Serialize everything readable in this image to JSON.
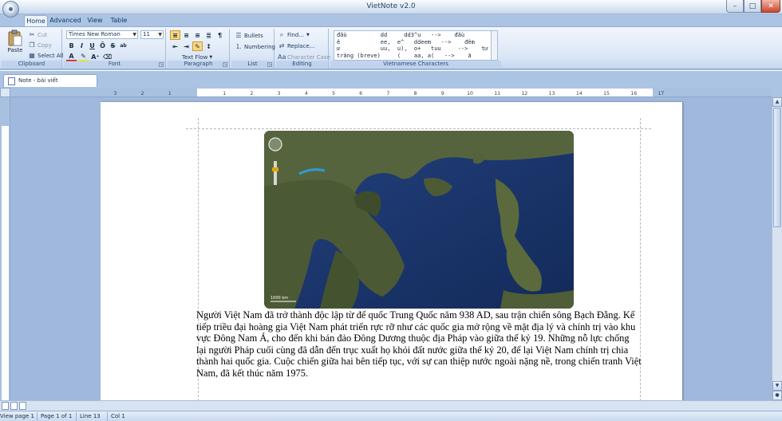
{
  "window": {
    "title": "VietNote v2.0",
    "min": "–",
    "max": "□",
    "close": "✕"
  },
  "ribbon_tabs": [
    "Home",
    "Advanced",
    "View",
    "Table"
  ],
  "clipboard": {
    "paste": "Paste",
    "cut": "Cut",
    "copy": "Copy",
    "select_all": "Select All",
    "label": "Clipboard"
  },
  "font": {
    "family": "Times New Roman",
    "size": "11",
    "label": "Font",
    "buttons": [
      "B",
      "I",
      "U",
      "Ō",
      "S",
      "ab"
    ]
  },
  "paragraph": {
    "text_flow": "Text Flow",
    "label": "Paragraph"
  },
  "list": {
    "bullets": "Bullets",
    "numbering": "Numbering",
    "label": "List"
  },
  "editing": {
    "find": "Find...",
    "replace": "Replace...",
    "character_case": "Character Case",
    "label": "Editing"
  },
  "vietnamese": {
    "label": "Vietnamese Characters",
    "lines": [
      "đầu          dd     dd3^u   -->    đầu",
      "ê            ee,  e^   ddeem   -->    đêm",
      "ư            uu,  u),  o+   tuu     -->    tư",
      "trăng (breve)     (    aa, a(   -->    ă"
    ]
  },
  "doc_tab": {
    "name": "Note - bài viết"
  },
  "ruler_numbers": [
    "3",
    "2",
    "1",
    "1",
    "2",
    "3",
    "4",
    "5",
    "6",
    "7",
    "8",
    "9",
    "10",
    "11",
    "12",
    "13",
    "14",
    "15",
    "16",
    "17"
  ],
  "map": {
    "scale": "1000 km"
  },
  "document": {
    "paragraph": "Người Việt Nam đã trở thành độc lập từ đế quốc Trung Quốc năm 938 AD, sau trận chiến sông Bạch Đằng. Kế tiếp triều đại hoàng gia Việt Nam phát triển rực rỡ như các quốc gia mở rộng về mặt địa lý và chính trị vào khu vực Đông Nam Á, cho đến khi bán đảo Đông Dương thuộc địa Pháp vào giữa thế kỷ 19. Những nỗ lực chống lại người Pháp cuối cùng đã dẫn đến trục xuất họ khỏi đất nước giữa thế kỷ 20, để lại Việt Nam chính trị chia thành hai quốc gia. Cuộc chiến giữa hai bên tiếp tục, với sự can thiệp nước ngoài nặng nề, trong chiến tranh Việt Nam, đã kết thúc năm 1975."
  },
  "status": {
    "view": "View page 1",
    "page": "Page 1 of 1",
    "line": "Line 13",
    "col": "Col 1"
  },
  "colors": {
    "ribbon": "#dbe7f6",
    "workspace": "#9fb8dc",
    "ocean": "#1d3a74",
    "land": "#4a5d36"
  },
  "icons": [
    "paste-icon",
    "cut-icon",
    "copy-icon",
    "select-all-icon",
    "font-color-icon",
    "highlight-icon",
    "bullets-icon",
    "numbering-icon",
    "find-icon",
    "replace-icon",
    "character-case-icon"
  ]
}
